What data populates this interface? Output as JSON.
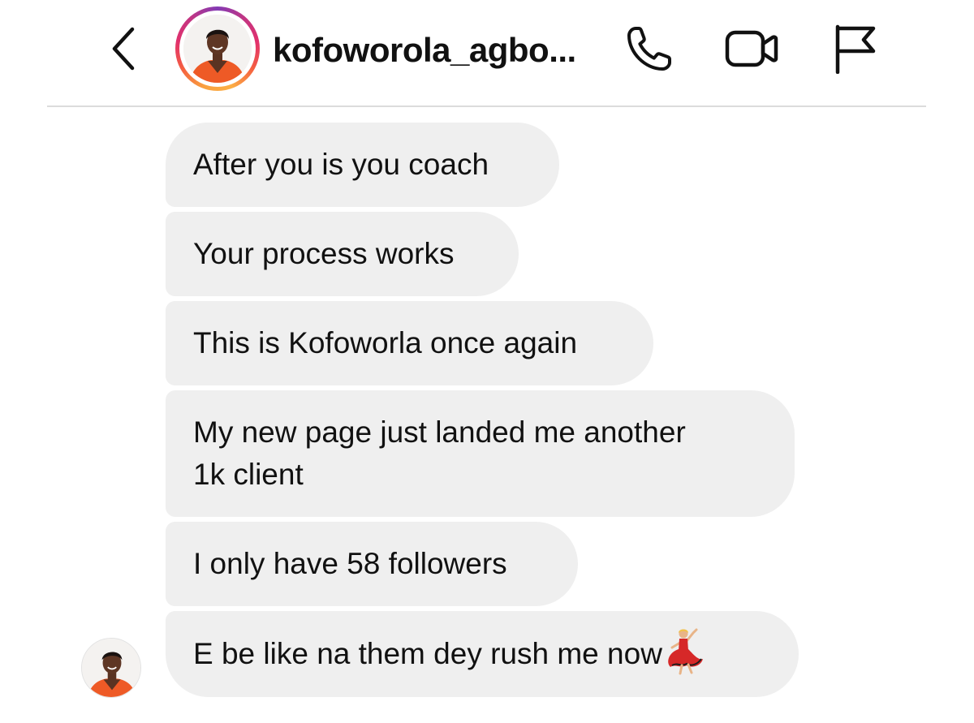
{
  "header": {
    "username": "kofoworola_agbo..."
  },
  "messages": [
    {
      "text": "After you is you coach"
    },
    {
      "text": "Your process works"
    },
    {
      "text": "This is Kofoworla once again"
    },
    {
      "text_line1": "My new page just landed me another",
      "text_line2": "1k client"
    },
    {
      "text": "I only have 58 followers"
    },
    {
      "text": "E be like na them dey rush me now",
      "emoji": "woman-dancing-icon"
    }
  ],
  "colors": {
    "bubble_background": "#efefef",
    "divider": "#dcdcdc",
    "text": "#111111",
    "story_ring": [
      "#fcaf45",
      "#f56040",
      "#e1306c",
      "#833ab4"
    ],
    "outfit_orange": "#ef5a24"
  }
}
